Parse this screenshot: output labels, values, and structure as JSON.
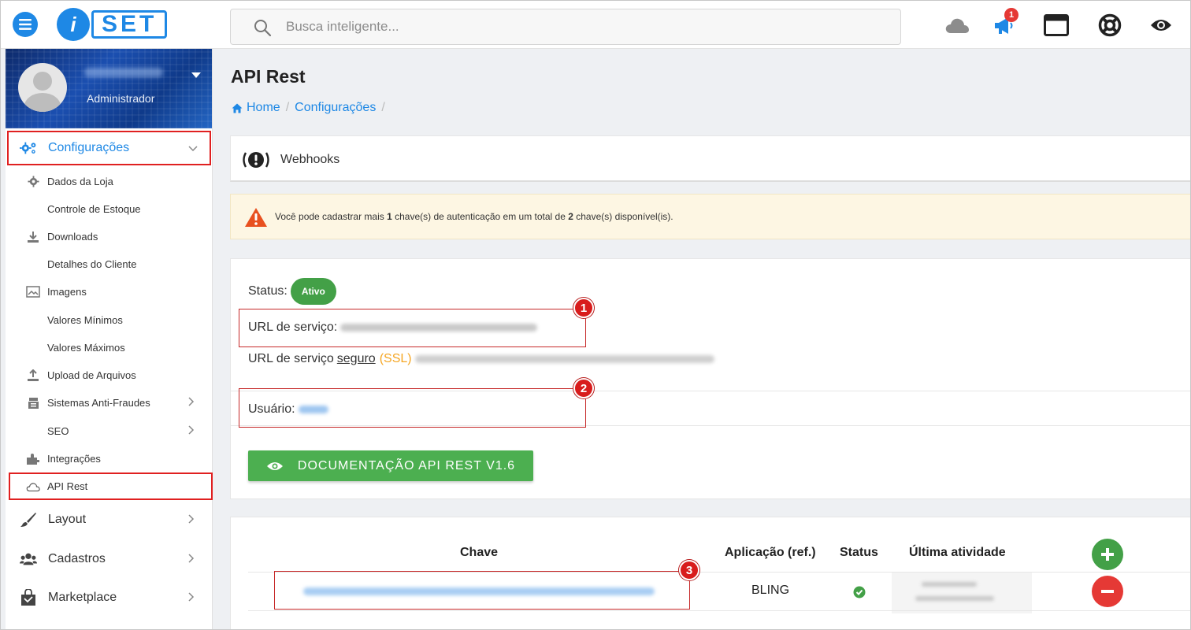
{
  "topbar": {
    "logo_text": "SET",
    "logo_letter": "i",
    "search_placeholder": "Busca inteligente...",
    "notification_count": "1",
    "icons": [
      "menu-icon",
      "search-icon",
      "cloud-icon",
      "megaphone-icon",
      "window-icon",
      "lifebuoy-icon",
      "eye-icon"
    ]
  },
  "sidebar": {
    "role": "Administrador",
    "config_label": "Configurações",
    "subitems": [
      {
        "label": "Dados da Loja",
        "icon": "gear-icon"
      },
      {
        "label": "Controle de Estoque",
        "icon": ""
      },
      {
        "label": "Downloads",
        "icon": "download-icon"
      },
      {
        "label": "Detalhes do Cliente",
        "icon": ""
      },
      {
        "label": "Imagens",
        "icon": "image-icon"
      },
      {
        "label": "Valores Mínimos",
        "icon": ""
      },
      {
        "label": "Valores Máximos",
        "icon": ""
      },
      {
        "label": "Upload de Arquivos",
        "icon": "upload-icon"
      },
      {
        "label": "Sistemas Anti-Fraudes",
        "icon": "fraud-icon"
      },
      {
        "label": "SEO",
        "icon": ""
      },
      {
        "label": "Integrações",
        "icon": "puzzle-icon"
      },
      {
        "label": "API Rest",
        "icon": "cloud-outline-icon"
      }
    ],
    "main_items": [
      {
        "label": "Layout",
        "icon": "brush-icon"
      },
      {
        "label": "Cadastros",
        "icon": "users-icon"
      },
      {
        "label": "Marketplace",
        "icon": "bag-icon"
      }
    ]
  },
  "page": {
    "title": "API Rest",
    "breadcrumb": [
      "Home",
      "Configurações"
    ],
    "breadcrumb_sep": "/"
  },
  "webhooks": {
    "label": "Webhooks"
  },
  "alert": {
    "pre": "Você pode cadastrar mais ",
    "count_available": "1",
    "mid": " chave(s) de autenticação em um total de ",
    "count_total": "2",
    "post": " chave(s) disponível(is)."
  },
  "info": {
    "status_label": "Status:",
    "status_value": "Ativo",
    "url_label": "URL de serviço:",
    "url_secure_prefix": "URL de serviço",
    "url_secure_word": "seguro",
    "url_secure_ssl": "(SSL)",
    "user_label": "Usuário:",
    "doc_button": "DOCUMENTAÇÃO API REST V1.6"
  },
  "table": {
    "headers": [
      "Chave",
      "Aplicação (ref.)",
      "Status",
      "Última atividade"
    ],
    "rows": [
      {
        "app": "BLING"
      }
    ]
  },
  "annotations": [
    "1",
    "2",
    "3"
  ],
  "colors": {
    "accent": "#1e88e5",
    "success": "#43a047",
    "danger": "#e53935",
    "highlight": "#e02020",
    "alert_bg": "#fdf6e3",
    "ssl": "#f5a623"
  }
}
